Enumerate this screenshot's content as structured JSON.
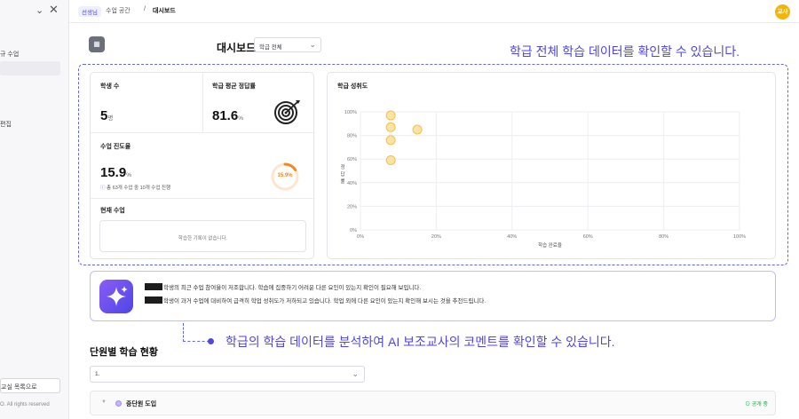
{
  "sidebar": {
    "items": [
      {
        "label": "규 수업"
      },
      {
        "label": "편집"
      }
    ],
    "back_button": "교실 목록으로",
    "copyright": "O. All rights reserved"
  },
  "topbar": {
    "role_chip": "선생님",
    "crumbs": [
      "수업 공간",
      "대시보드"
    ],
    "separator": "/",
    "avatar": "교사"
  },
  "dashboard": {
    "title": "대시보드",
    "filter": "학급 전체",
    "annotation": "학급 전체 학습 데이터를 확인할 수 있습니다."
  },
  "stats": {
    "students_label": "학생 수",
    "students_value": "5",
    "students_unit": "명",
    "accuracy_label": "학급 평균 정답률",
    "accuracy_value": "81.6",
    "accuracy_unit": "%",
    "progress_label": "수업 진도율",
    "progress_value": "15.9",
    "progress_unit": "%",
    "progress_note": "총 63개 수업 중 10개 수업 진행",
    "progress_ring": "15.9%",
    "progress_fraction": 0.159,
    "current_label": "현재 수업",
    "current_empty": "학습한 기록이 없습니다."
  },
  "chart_data": {
    "type": "scatter",
    "title": "학급 성취도",
    "xlabel": "학습 완료율",
    "ylabel": "정답률",
    "x_ticks": [
      "0%",
      "20%",
      "40%",
      "60%",
      "80%",
      "100%"
    ],
    "y_ticks": [
      "0%",
      "20%",
      "40%",
      "60%",
      "80%",
      "100%"
    ],
    "xlim": [
      0,
      100
    ],
    "ylim": [
      0,
      100
    ],
    "grid": true,
    "points": [
      {
        "x": 8,
        "y": 97
      },
      {
        "x": 8,
        "y": 87
      },
      {
        "x": 8,
        "y": 76
      },
      {
        "x": 8,
        "y": 59
      },
      {
        "x": 15,
        "y": 85
      }
    ],
    "point_color": "#fbe3a6",
    "point_stroke": "#f2c14e"
  },
  "ai": {
    "lines": [
      "학생의 최근 수업 참여율이 저조합니다. 학습에 집중하기 어려운 다른 요인이 있는지 확인이 필요해 보입니다.",
      "학생이 과거 수업에 대비하여 급격히 학업 성취도가 저하되고 있습니다. 학업 외에 다른 요인이 있는지 확인해 보시는 것을 추천드립니다."
    ],
    "annotation": "학급의 학습 데이터를 분석하여 AI 보조교사의 코멘트를 확인할 수 있습니다."
  },
  "units": {
    "title": "단원별 학습 현황",
    "select_value": "1.",
    "row_label": "중단원 도입",
    "row_badge": "공개 중"
  },
  "colors": {
    "accent": "#4f46e5",
    "avatar": "#f4b400",
    "ring": "#f08a24"
  }
}
